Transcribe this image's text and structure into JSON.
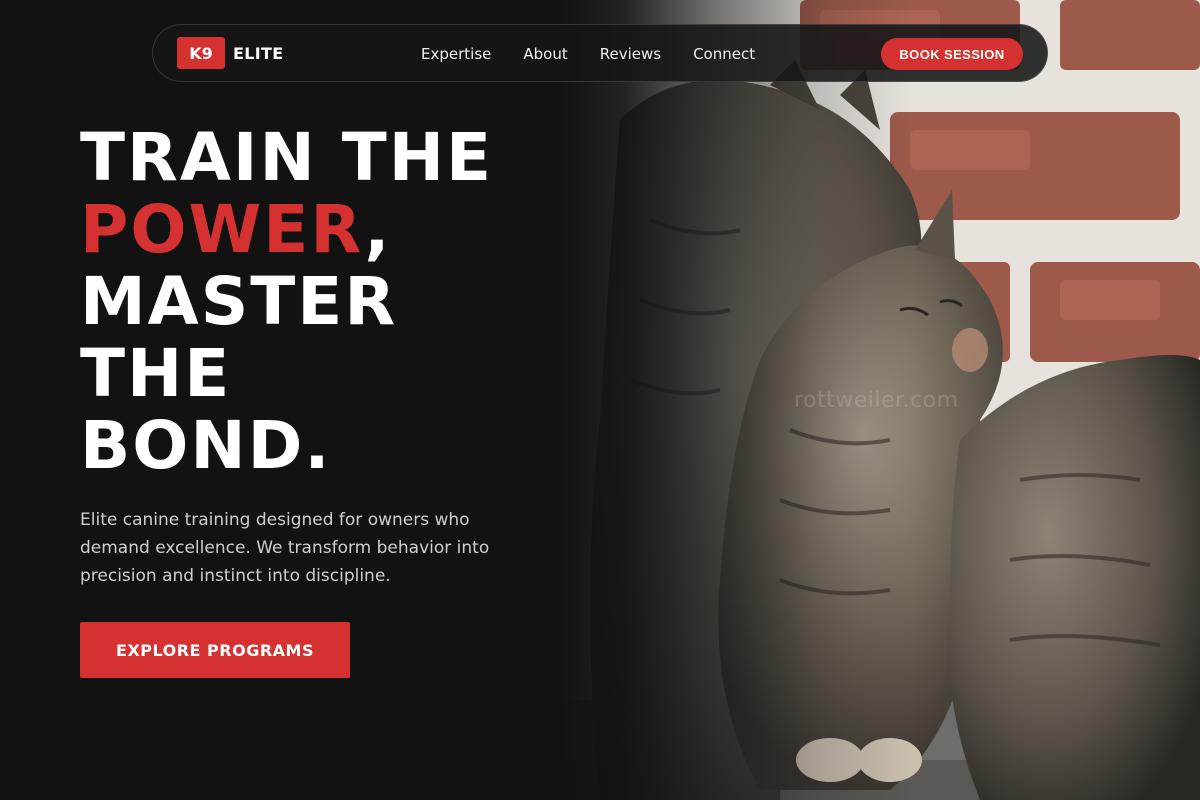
{
  "brand": {
    "badge": "K9",
    "name": "ELITE",
    "accent_color": "#d63131"
  },
  "nav": {
    "links": [
      "Expertise",
      "About",
      "Reviews",
      "Connect"
    ],
    "cta_label": "BOOK SESSION"
  },
  "hero": {
    "headline": {
      "line1": "TRAIN THE",
      "line2_accent": "POWER",
      "line2_rest": ",",
      "line3": "MASTER",
      "line4": "THE",
      "line5": "BOND."
    },
    "subcopy": "Elite canine training designed for owners who demand excellence. We transform behavior into precision and instinct into discipline.",
    "cta_label": "EXPLORE PROGRAMS",
    "image_watermark": "rottweiler.com",
    "image_subject": "two tabby cats nuzzling in front of a brick wall"
  },
  "colors": {
    "background": "#121213",
    "accent": "#d63131",
    "text_primary": "#ffffff",
    "text_secondary": "#cfcfcf"
  }
}
